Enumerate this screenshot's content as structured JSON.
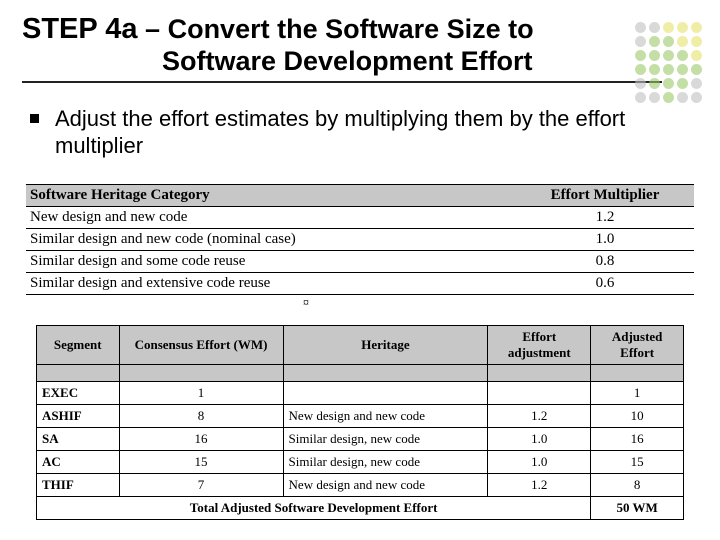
{
  "title": {
    "step": "STEP 4a",
    "dash": " – ",
    "line1_rest": "Convert the Software Size to",
    "line2": "Software Development Effort"
  },
  "bullet": "Adjust the effort estimates by multiplying them by the effort multiplier",
  "table1": {
    "headers": {
      "category": "Software Heritage Category",
      "multiplier": "Effort Multiplier"
    },
    "rows": [
      {
        "category": "New design and new code",
        "multiplier": "1.2"
      },
      {
        "category": "Similar design and new code (nominal case)",
        "multiplier": "1.0"
      },
      {
        "category": "Similar design and some code reuse",
        "multiplier": "0.8"
      },
      {
        "category": "Similar design and extensive code reuse",
        "multiplier": "0.6"
      }
    ]
  },
  "table2": {
    "headers": {
      "segment": "Segment",
      "consensus": "Consensus Effort (WM)",
      "heritage": "Heritage",
      "adjustment": "Effort adjustment",
      "adjusted": "Adjusted Effort"
    },
    "rows": [
      {
        "segment": "EXEC",
        "consensus": "1",
        "heritage": "",
        "adjustment": "",
        "adjusted": "1"
      },
      {
        "segment": "ASHIF",
        "consensus": "8",
        "heritage": "New design and new code",
        "adjustment": "1.2",
        "adjusted": "10"
      },
      {
        "segment": "SA",
        "consensus": "16",
        "heritage": "Similar design, new code",
        "adjustment": "1.0",
        "adjusted": "16"
      },
      {
        "segment": "AC",
        "consensus": "15",
        "heritage": "Similar design, new code",
        "adjustment": "1.0",
        "adjusted": "15"
      },
      {
        "segment": "THIF",
        "consensus": "7",
        "heritage": "New design and new code",
        "adjustment": "1.2",
        "adjusted": "8"
      }
    ],
    "total_label": "Total Adjusted Software Development Effort",
    "total_value": "50 WM"
  },
  "deco_colors": [
    "#bfbfbf",
    "#bfbfbf",
    "#e6e26a",
    "#e6e26a",
    "#e6e26a",
    "#bfbfbf",
    "#9cc96a",
    "#9cc96a",
    "#e6e26a",
    "#e6e26a",
    "#9cc96a",
    "#9cc96a",
    "#9cc96a",
    "#9cc96a",
    "#e6e26a",
    "#9cc96a",
    "#9cc96a",
    "#9cc96a",
    "#9cc96a",
    "#9cc96a",
    "#bfbfbf",
    "#9cc96a",
    "#9cc96a",
    "#9cc96a",
    "#bfbfbf",
    "#bfbfbf",
    "#bfbfbf",
    "#9cc96a",
    "#bfbfbf",
    "#bfbfbf"
  ],
  "cursor_char": "¤"
}
